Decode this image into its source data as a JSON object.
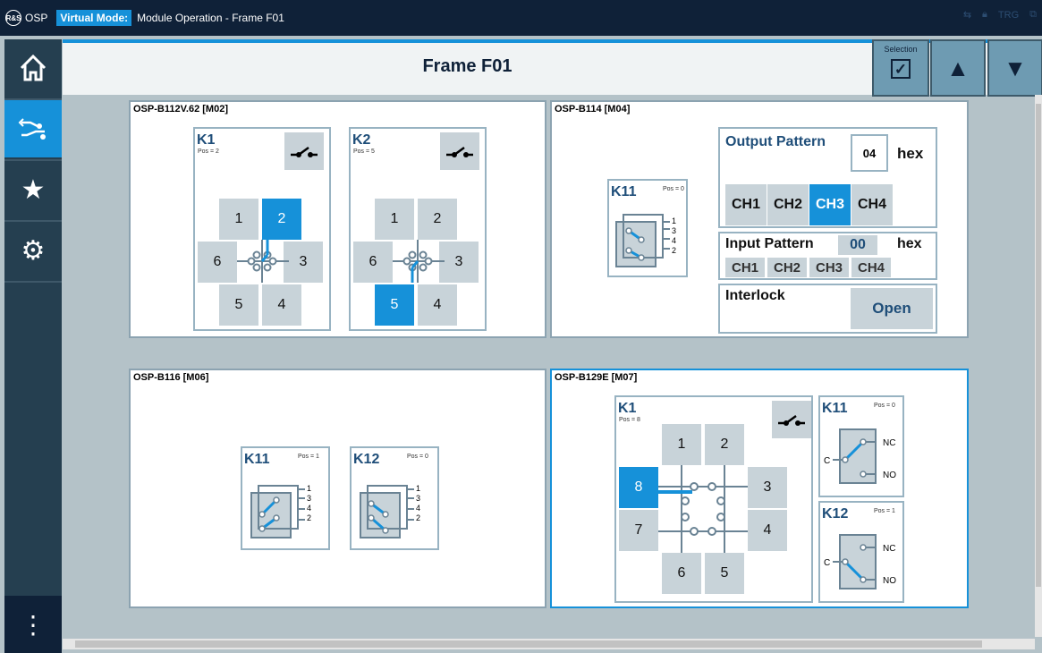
{
  "app": {
    "logo_text": "OSP",
    "virtual_mode": "Virtual Mode:",
    "title": "Module Operation - Frame F01",
    "trg": "TRG"
  },
  "header": {
    "title": "Frame F01",
    "selection_label": "Selection"
  },
  "colors": {
    "accent": "#1691d9",
    "titlebar": "#0f2138",
    "sidebar": "#253f50"
  },
  "sidebar": {
    "items": [
      {
        "icon": "home-icon"
      },
      {
        "icon": "switch-icon"
      },
      {
        "icon": "star-icon"
      },
      {
        "icon": "gear-icon"
      }
    ],
    "menu_icon": "more-icon"
  },
  "modules": {
    "m02": {
      "title": "OSP-B112V.62  [M02]",
      "k1": {
        "name": "K1",
        "pos": "Pos = 2",
        "cells": [
          "1",
          "2",
          "6",
          "3",
          "5",
          "4"
        ]
      },
      "k2": {
        "name": "K2",
        "pos": "Pos = 5",
        "cells": [
          "1",
          "2",
          "6",
          "3",
          "5",
          "4"
        ]
      }
    },
    "m04": {
      "title": "OSP-B114  [M04]",
      "k11": {
        "name": "K11",
        "pos": "Pos = 0",
        "ports": [
          "1",
          "3",
          "4",
          "2"
        ]
      },
      "output": {
        "title": "Output Pattern",
        "value": "04",
        "unit": "hex",
        "channels": [
          "CH1",
          "CH2",
          "CH3",
          "CH4"
        ],
        "active": "CH3"
      },
      "input": {
        "title": "Input Pattern",
        "value": "00",
        "unit": "hex",
        "channels": [
          "CH1",
          "CH2",
          "CH3",
          "CH4"
        ]
      },
      "interlock": {
        "title": "Interlock",
        "state": "Open"
      }
    },
    "m06": {
      "title": "OSP-B116  [M06]",
      "k11": {
        "name": "K11",
        "pos": "Pos = 1",
        "ports": [
          "1",
          "3",
          "4",
          "2"
        ]
      },
      "k12": {
        "name": "K12",
        "pos": "Pos = 0",
        "ports": [
          "1",
          "3",
          "4",
          "2"
        ]
      }
    },
    "m07": {
      "title": "OSP-B129E  [M07]",
      "k1": {
        "name": "K1",
        "pos": "Pos = 8",
        "cells": [
          "1",
          "2",
          "8",
          "3",
          "7",
          "4",
          "6",
          "5"
        ]
      },
      "k11": {
        "name": "K11",
        "pos": "Pos = 0",
        "c": "C",
        "nc": "NC",
        "no": "NO"
      },
      "k12": {
        "name": "K12",
        "pos": "Pos = 1",
        "c": "C",
        "nc": "NC",
        "no": "NO"
      }
    }
  }
}
